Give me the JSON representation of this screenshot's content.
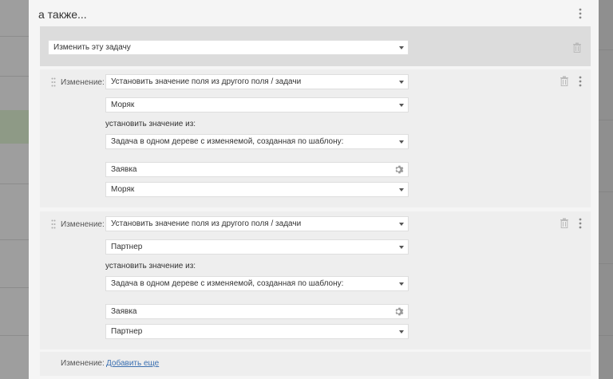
{
  "dialog": {
    "title": "а также...",
    "top_action": {
      "value": "Изменить эту задачу"
    },
    "changes": [
      {
        "label": "Изменение:",
        "action": "Установить значение поля из другого поля / задачи",
        "field": "Моряк",
        "source_label": "установить значение из:",
        "source": "Задача в одном дереве с изменяемой, созданная по шаблону:",
        "template": "Заявка",
        "source_field": "Моряк"
      },
      {
        "label": "Изменение:",
        "action": "Установить значение поля из другого поля / задачи",
        "field": "Партнер",
        "source_label": "установить значение из:",
        "source": "Задача в одном дереве с изменяемой, созданная по шаблону:",
        "template": "Заявка",
        "source_field": "Партнер"
      }
    ],
    "add_row": {
      "label": "Изменение:",
      "link": "Добавить еще"
    }
  },
  "colors": {
    "link": "#3a6fb0",
    "panel": "#f5f5f5",
    "block": "#eeeeee"
  },
  "icons": [
    "kebab-icon",
    "trash-icon",
    "drag-handle-icon",
    "gear-icon",
    "chevron-down-icon"
  ]
}
